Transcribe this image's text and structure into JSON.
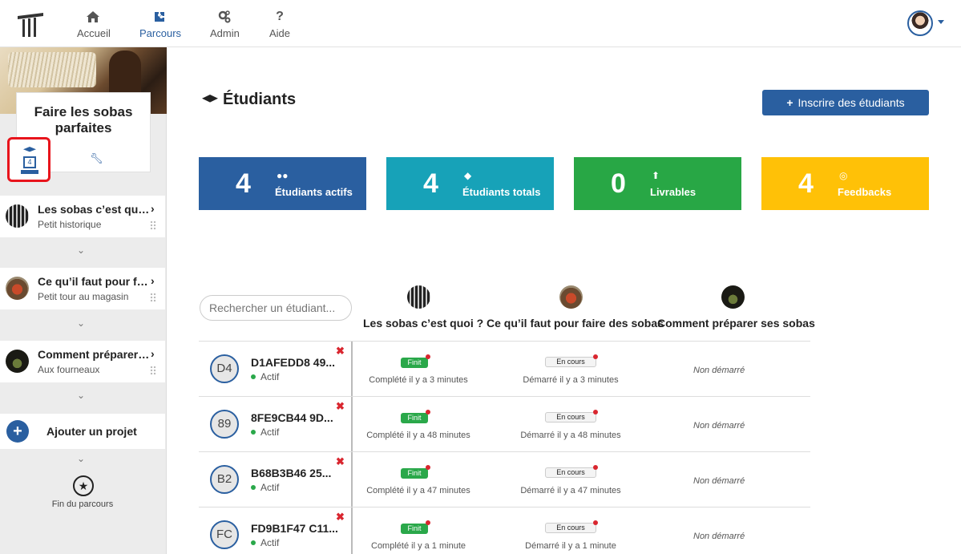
{
  "nav": {
    "items": [
      {
        "label": "Accueil",
        "icon": "home-icon"
      },
      {
        "label": "Parcours",
        "icon": "puzzle-icon"
      },
      {
        "label": "Admin",
        "icon": "gears-icon"
      },
      {
        "label": "Aide",
        "icon": "question-icon"
      }
    ],
    "active": "Parcours"
  },
  "sidebar": {
    "project_title": "Faire les sobas parfaites",
    "student_count_badge": "4",
    "chapters": [
      {
        "title": "Les sobas c’est quoi ?",
        "subtitle": "Petit historique"
      },
      {
        "title": "Ce qu’il faut pour faire des sobas",
        "subtitle": "Petit tour au magasin"
      },
      {
        "title": "Comment préparer ses sobas",
        "subtitle": "Aux fourneaux"
      }
    ],
    "add_project_label": "Ajouter un projet",
    "end_label": "Fin du parcours"
  },
  "main": {
    "title": "Étudiants",
    "enroll_button": "Inscrire des étudiants",
    "stats": [
      {
        "value": "4",
        "label": "Étudiants actifs",
        "color": "#2a5fa0",
        "icon": "users-icon"
      },
      {
        "value": "4",
        "label": "Étudiants totals",
        "color": "#17a2b8",
        "icon": "graduation-cap-icon"
      },
      {
        "value": "0",
        "label": "Livrables",
        "color": "#28a745",
        "icon": "upload-icon"
      },
      {
        "value": "4",
        "label": "Feedbacks",
        "color": "#ffc107",
        "icon": "medal-icon"
      }
    ],
    "search_placeholder": "Rechercher un étudiant...",
    "columns": [
      "Les sobas c’est quoi ?",
      "Ce qu’il faut pour faire des sobas",
      "Comment préparer ses sobas"
    ],
    "students": [
      {
        "initials": "D4",
        "name": "D1AFEDD8 49...",
        "status": "Actif",
        "c1": {
          "pill": "Finit",
          "note": "Complété il y a 3 minutes"
        },
        "c2": {
          "pill": "En cours",
          "note": "Démarré il y a 3 minutes"
        },
        "c3": "Non démarré"
      },
      {
        "initials": "89",
        "name": "8FE9CB44 9D...",
        "status": "Actif",
        "c1": {
          "pill": "Finit",
          "note": "Complété il y a 48 minutes"
        },
        "c2": {
          "pill": "En cours",
          "note": "Démarré il y a 48 minutes"
        },
        "c3": "Non démarré"
      },
      {
        "initials": "B2",
        "name": "B68B3B46 25...",
        "status": "Actif",
        "c1": {
          "pill": "Finit",
          "note": "Complété il y a 47 minutes"
        },
        "c2": {
          "pill": "En cours",
          "note": "Démarré il y a 47 minutes"
        },
        "c3": "Non démarré"
      },
      {
        "initials": "FC",
        "name": "FD9B1F47 C11...",
        "status": "Actif",
        "c1": {
          "pill": "Finit",
          "note": "Complété il y a 1 minute"
        },
        "c2": {
          "pill": "En cours",
          "note": "Démarré il y a 1 minute"
        },
        "c3": "Non démarré"
      }
    ]
  }
}
